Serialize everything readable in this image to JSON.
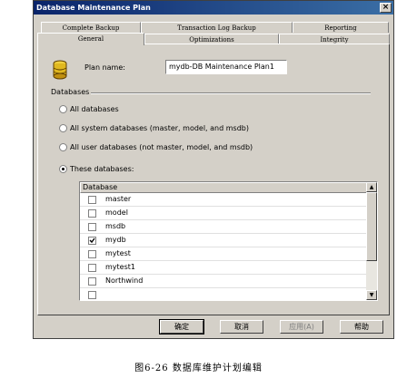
{
  "window": {
    "title": "Database Maintenance Plan",
    "close_glyph": "×"
  },
  "tabs": {
    "row1": [
      "Complete Backup",
      "Transaction Log Backup",
      "Reporting"
    ],
    "row2": [
      "General",
      "Optimizations",
      "Integrity"
    ],
    "active": "General"
  },
  "general": {
    "plan_name_label": "Plan name:",
    "plan_name_value": "mydb-DB Maintenance Plan1",
    "group_label": "Databases",
    "options": [
      {
        "label": "All databases",
        "selected": false
      },
      {
        "label": "All system databases (master, model, and msdb)",
        "selected": false
      },
      {
        "label": "All user databases (not master, model, and msdb)",
        "selected": false
      },
      {
        "label": "These databases:",
        "selected": true
      }
    ],
    "list_header": "Database",
    "databases": [
      {
        "name": "master",
        "checked": false
      },
      {
        "name": "model",
        "checked": false
      },
      {
        "name": "msdb",
        "checked": false
      },
      {
        "name": "mydb",
        "checked": true
      },
      {
        "name": "mytest",
        "checked": false
      },
      {
        "name": "mytest1",
        "checked": false
      },
      {
        "name": "Northwind",
        "checked": false
      }
    ]
  },
  "buttons": {
    "ok": "确定",
    "cancel": "取消",
    "apply": "应用(A)",
    "help": "帮助"
  },
  "caption": "图6-26  数据库维护计划编辑"
}
